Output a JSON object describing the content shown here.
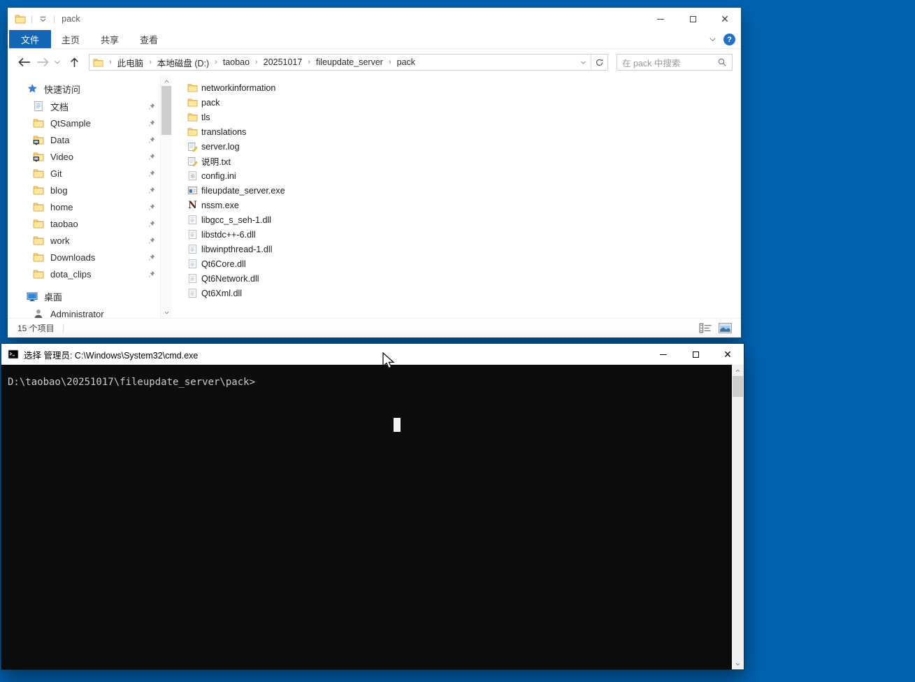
{
  "desktop": {
    "background_color": "#0063b1"
  },
  "explorer": {
    "titlebar": {
      "title": "pack"
    },
    "tabs": [
      {
        "label": "文件"
      },
      {
        "label": "主页"
      },
      {
        "label": "共享"
      },
      {
        "label": "查看"
      }
    ],
    "address": {
      "crumbs": [
        "此电脑",
        "本地磁盘 (D:)",
        "taobao",
        "20251017",
        "fileupdate_server",
        "pack"
      ]
    },
    "search": {
      "placeholder": "在 pack 中搜索"
    },
    "sidebar": {
      "quick_access_label": "快速访问",
      "pinned_items": [
        {
          "label": "文档",
          "icon": "document"
        },
        {
          "label": "QtSample",
          "icon": "folder"
        },
        {
          "label": "Data",
          "icon": "folder-monitor"
        },
        {
          "label": "Video",
          "icon": "folder-monitor"
        },
        {
          "label": "Git",
          "icon": "folder"
        },
        {
          "label": "blog",
          "icon": "folder"
        },
        {
          "label": "home",
          "icon": "folder"
        },
        {
          "label": "taobao",
          "icon": "folder"
        },
        {
          "label": "work",
          "icon": "folder"
        },
        {
          "label": "Downloads",
          "icon": "folder"
        },
        {
          "label": "dota_clips",
          "icon": "folder"
        }
      ],
      "desktop_label": "桌面",
      "user_label": "Administrator"
    },
    "files": [
      {
        "name": "networkinformation",
        "icon": "folder"
      },
      {
        "name": "pack",
        "icon": "folder"
      },
      {
        "name": "tls",
        "icon": "folder"
      },
      {
        "name": "translations",
        "icon": "folder"
      },
      {
        "name": "server.log",
        "icon": "log"
      },
      {
        "name": "说明.txt",
        "icon": "log"
      },
      {
        "name": "config.ini",
        "icon": "ini"
      },
      {
        "name": "fileupdate_server.exe",
        "icon": "exe"
      },
      {
        "name": "nssm.exe",
        "icon": "nssm"
      },
      {
        "name": "libgcc_s_seh-1.dll",
        "icon": "dll"
      },
      {
        "name": "libstdc++-6.dll",
        "icon": "dll"
      },
      {
        "name": "libwinpthread-1.dll",
        "icon": "dll"
      },
      {
        "name": "Qt6Core.dll",
        "icon": "dll"
      },
      {
        "name": "Qt6Network.dll",
        "icon": "dll"
      },
      {
        "name": "Qt6Xml.dll",
        "icon": "dll"
      }
    ],
    "statusbar": {
      "items_count": "15 个项目"
    }
  },
  "cmd": {
    "title": "选择 管理员: C:\\Windows\\System32\\cmd.exe",
    "prompt": "D:\\taobao\\20251017\\fileupdate_server\\pack>"
  },
  "colors": {
    "file_tab_blue": "#1765b5",
    "console_background": "#0c0c0c",
    "console_text": "#cccccc"
  }
}
